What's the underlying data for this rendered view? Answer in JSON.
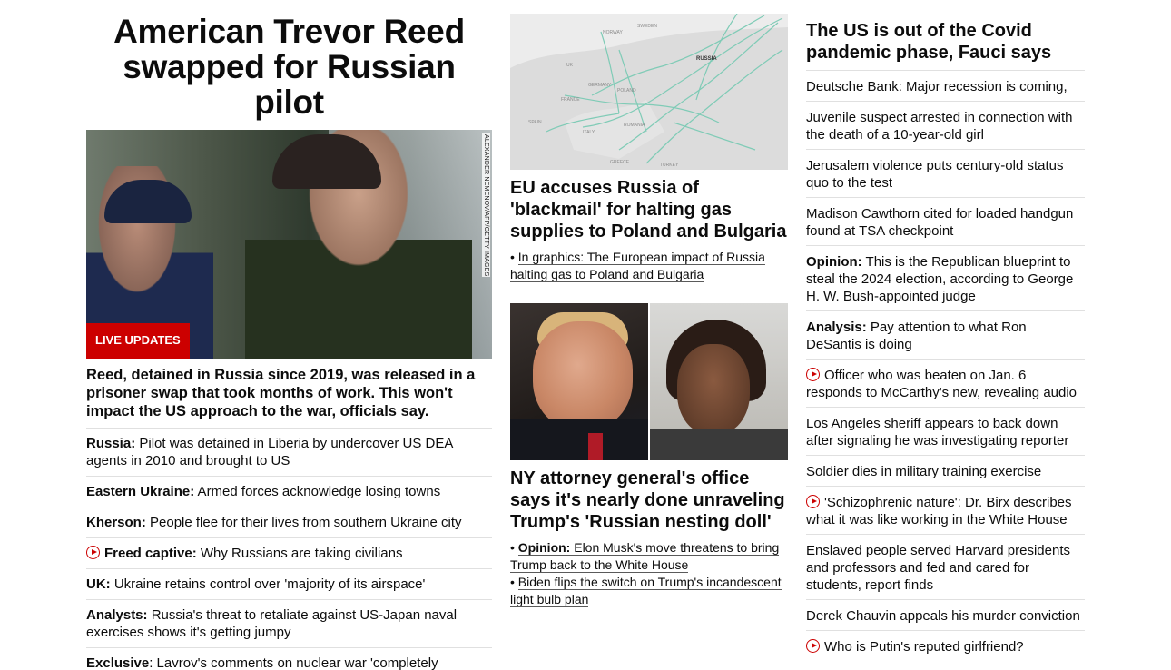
{
  "lead": {
    "title": "American Trevor Reed swapped for Russian pilot",
    "image_credit": "ALEXANDER NEMENOV/AFP/GETTY IMAGES",
    "badge": "LIVE UPDATES",
    "description": "Reed, detained in Russia since 2019, was released in a prisoner swap that took months of work. This won't impact the US approach to the war, officials say.",
    "items": [
      {
        "kicker": "Russia:",
        "text": " Pilot was detained in Liberia by undercover US DEA agents in 2010 and brought to US"
      },
      {
        "kicker": "Eastern Ukraine:",
        "text": " Armed forces acknowledge losing towns"
      },
      {
        "kicker": "Kherson:",
        "text": " People flee for their lives from southern Ukraine city"
      },
      {
        "kicker": "Freed captive:",
        "text": " Why Russians are taking civilians",
        "video": true
      },
      {
        "kicker": "UK:",
        "text": " Ukraine retains control over 'majority of its airspace'"
      },
      {
        "kicker": "Analysts:",
        "text": " Russia's threat to retaliate against US-Japan naval exercises shows it's getting jumpy"
      },
      {
        "kicker": "Exclusive",
        "text": ": Lavrov's comments on nuclear war 'completely irresponsible,' Milley says"
      }
    ]
  },
  "middle": {
    "map_labels": [
      "SWEDEN",
      "NORWAY",
      "RUSSIA",
      "GERMANY",
      "POLAND",
      "FRANCE",
      "SPAIN",
      "ITALY",
      "ROMANIA",
      "GREECE",
      "TURKEY",
      "UK"
    ],
    "story1": {
      "headline": "EU accuses Russia of 'blackmail' for halting gas supplies to Poland and Bulgaria",
      "link": "In graphics: The European impact of Russia halting gas to Poland and Bulgaria"
    },
    "story2": {
      "headline": "NY attorney general's office says it's nearly done unraveling Trump's 'Russian nesting doll'",
      "link1_kicker": "Opinion:",
      "link1_text": " Elon Musk's move threatens to bring Trump back to the White House",
      "link2": "Biden flips the switch on Trump's incandescent light bulb plan"
    }
  },
  "right": {
    "headline": "The US is out of the Covid pandemic phase, Fauci says",
    "items": [
      {
        "kicker": "",
        "text": "Deutsche Bank: Major recession is coming,"
      },
      {
        "kicker": "",
        "text": "Juvenile suspect arrested in connection with the death of a 10-year-old girl"
      },
      {
        "kicker": "",
        "text": "Jerusalem violence puts century-old status quo to the test"
      },
      {
        "kicker": "",
        "text": "Madison Cawthorn cited for loaded handgun found at TSA checkpoint"
      },
      {
        "kicker": "Opinion:",
        "text": " This is the Republican blueprint to steal the 2024 election, according to George H. W. Bush-appointed judge"
      },
      {
        "kicker": "Analysis:",
        "text": " Pay attention to what Ron DeSantis is doing"
      },
      {
        "kicker": "",
        "text": "Officer who was beaten on Jan. 6 responds to McCarthy's new, revealing audio",
        "video": true
      },
      {
        "kicker": "",
        "text": "Los Angeles sheriff appears to back down after signaling he was investigating reporter"
      },
      {
        "kicker": "",
        "text": "Soldier dies in military training exercise"
      },
      {
        "kicker": "",
        "text": "'Schizophrenic nature': Dr. Birx describes what it was like working in the White House",
        "video": true
      },
      {
        "kicker": "",
        "text": "Enslaved people served Harvard presidents and professors and fed and cared for students, report finds"
      },
      {
        "kicker": "",
        "text": "Derek Chauvin appeals his murder conviction"
      },
      {
        "kicker": "",
        "text": "Who is Putin's reputed girlfriend?",
        "video": true
      }
    ]
  },
  "colors": {
    "accent": "#cc0000",
    "text": "#0c0c0c",
    "divider": "#e0e0e0"
  }
}
